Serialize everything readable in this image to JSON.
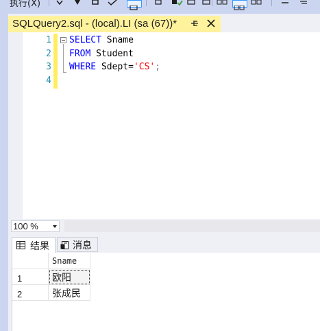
{
  "toolbar": {
    "execute_label": "执行(X)"
  },
  "document_tab": {
    "title": "SQLQuery2.sql - (local).LI (sa (67))*",
    "pin_icon": "pin-icon",
    "close_icon": "close-icon"
  },
  "editor": {
    "line_numbers": [
      "1",
      "2",
      "3",
      "4"
    ],
    "lines": [
      {
        "keyword": "SELECT",
        "rest": " Sname"
      },
      {
        "keyword": "FROM",
        "rest": " Student"
      },
      {
        "keyword": "WHERE",
        "rest": " Sdept=",
        "string": "'CS'",
        "end": ";"
      },
      {
        "keyword": "",
        "rest": ""
      }
    ]
  },
  "zoom": {
    "value": "100 %"
  },
  "results_tabs": [
    {
      "label": "结果",
      "icon": "grid-icon"
    },
    {
      "label": "消息",
      "icon": "message-icon"
    }
  ],
  "results_grid": {
    "columns": [
      "Sname"
    ],
    "rows": [
      {
        "num": "1",
        "values": [
          "欧阳"
        ]
      },
      {
        "num": "2",
        "values": [
          "张成民"
        ]
      }
    ]
  },
  "colors": {
    "toolbar_bg": "#CCD5F0",
    "tab_active_bg": "#FFF29D",
    "keyword": "#0000FF",
    "string": "#FF0000",
    "line_number": "#2B91AF",
    "change_bar": "#FFEE62"
  }
}
